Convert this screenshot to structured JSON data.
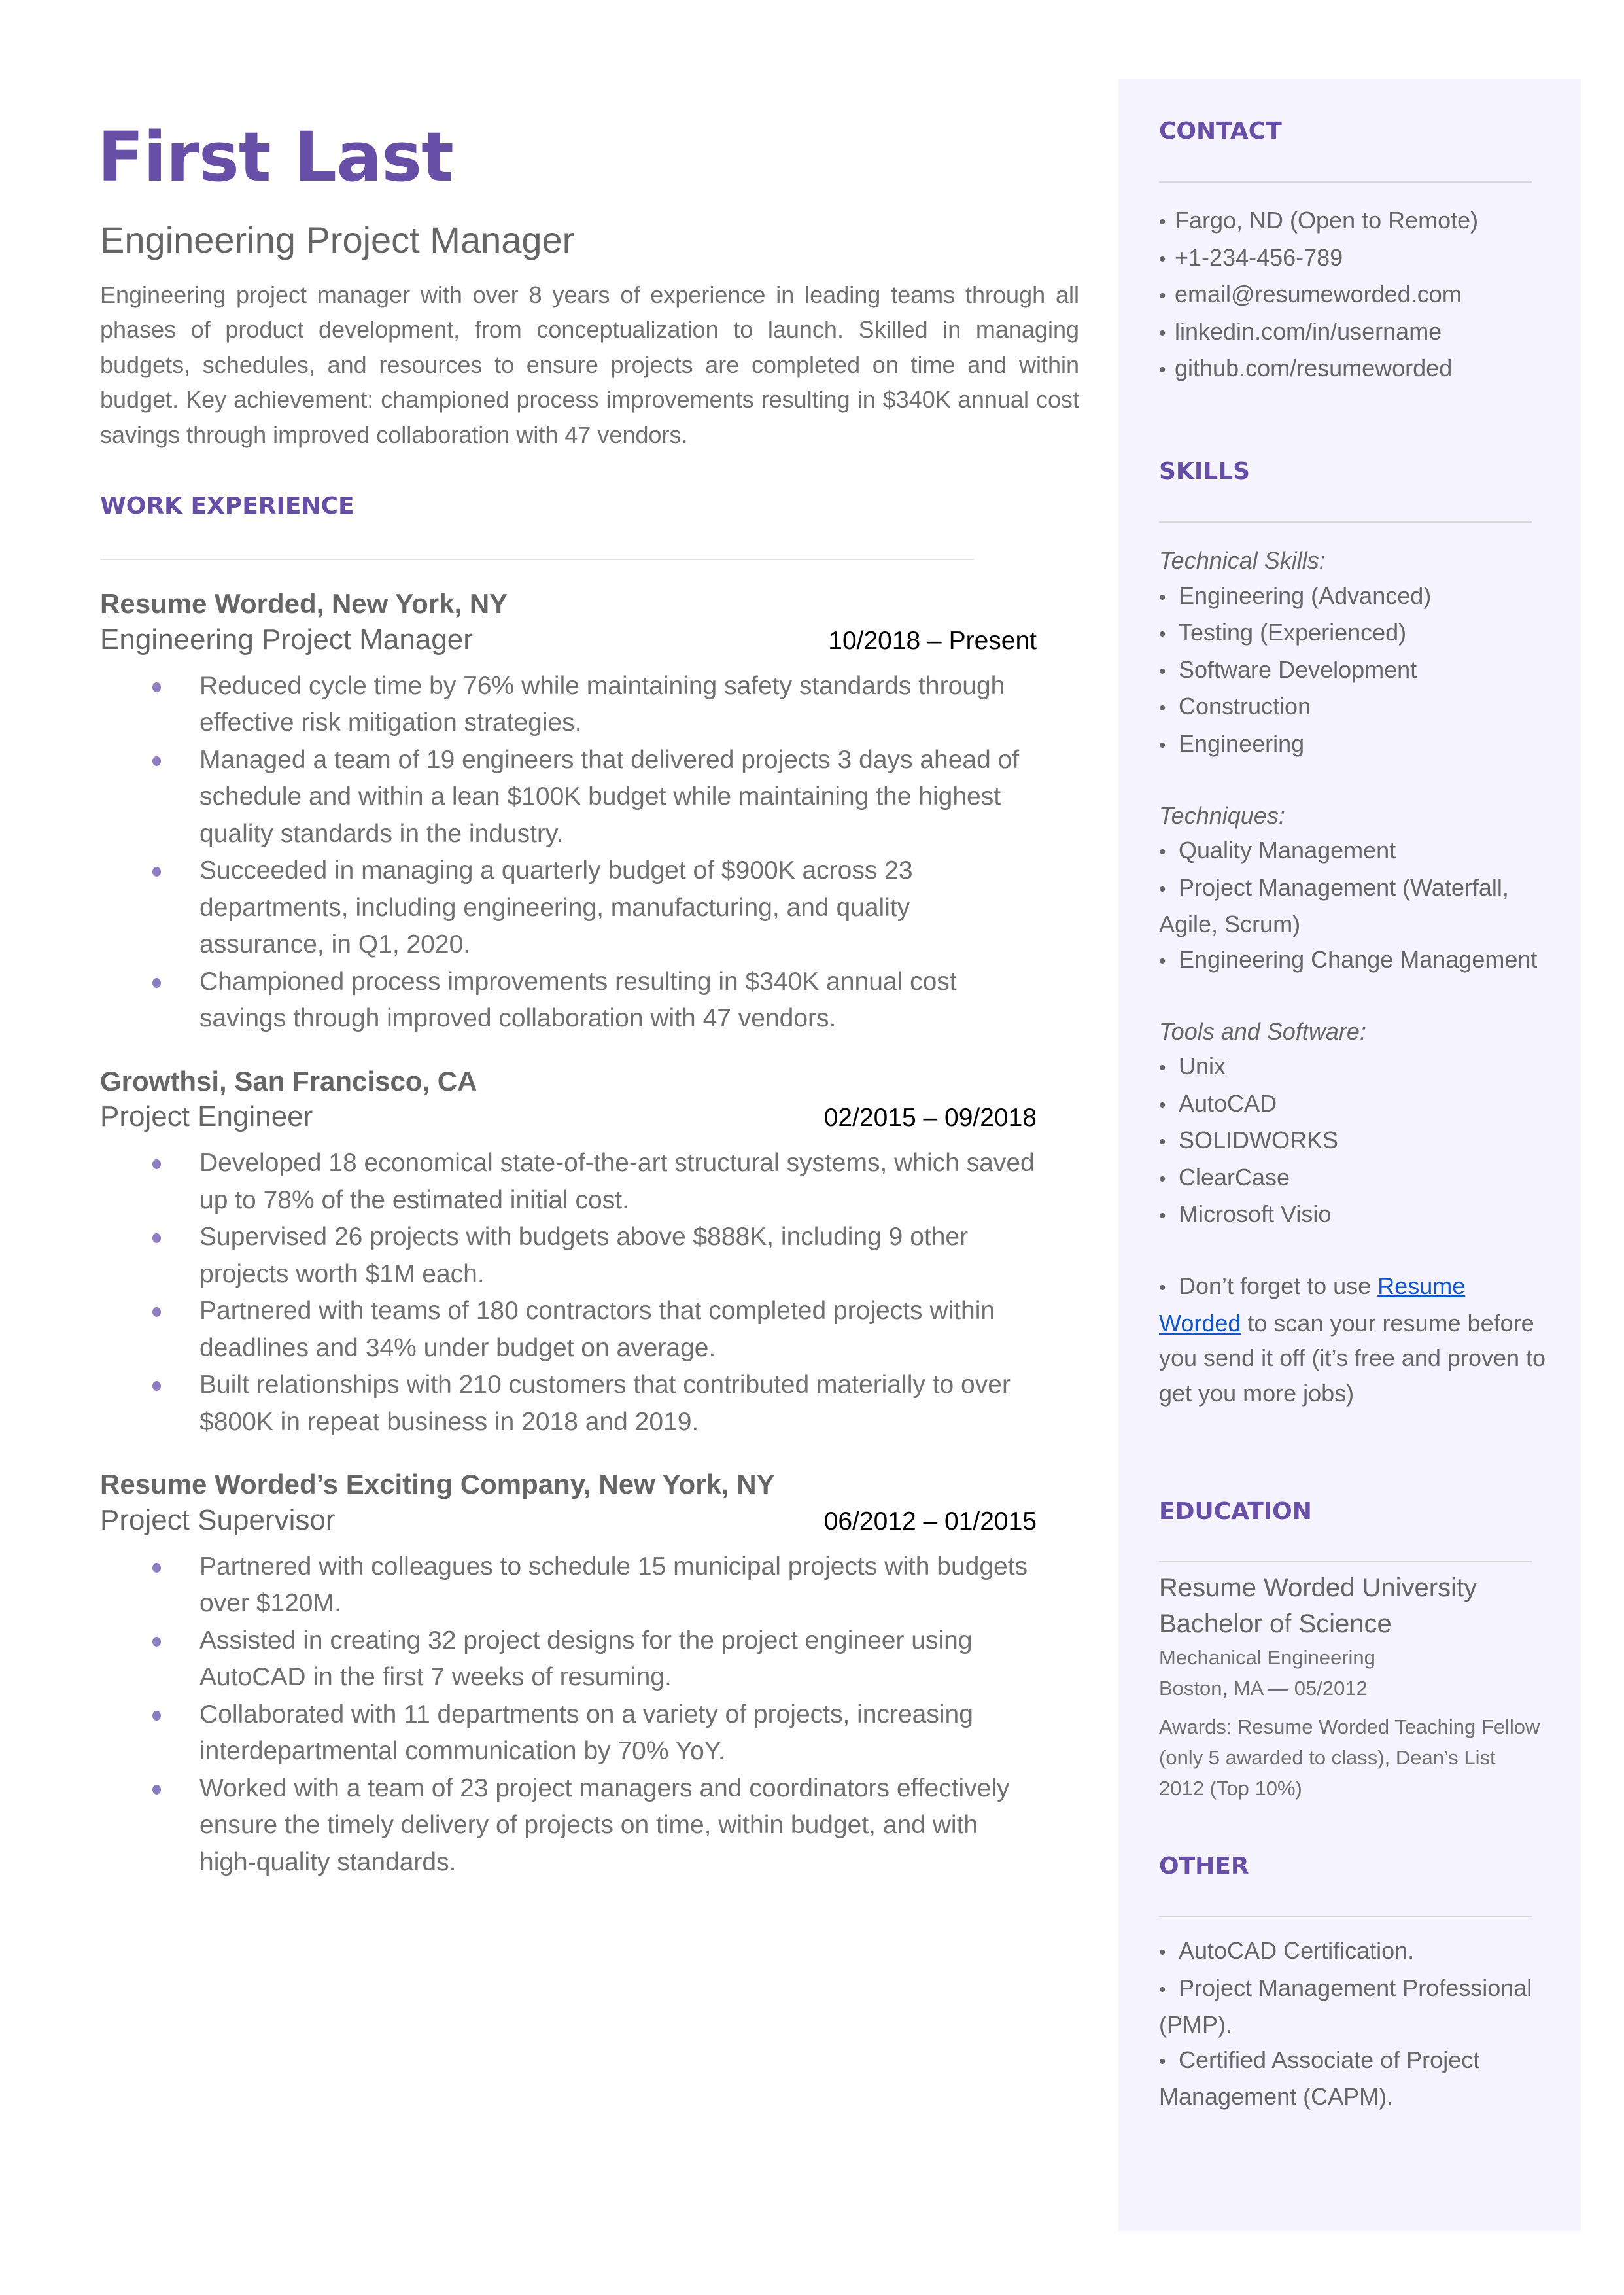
{
  "header": {
    "name": "First Last",
    "title": "Engineering Project Manager",
    "summary": "Engineering project manager with over 8 years of experience in leading teams through all phases of product development, from conceptualization to launch. Skilled in managing budgets, schedules, and resources to ensure projects are completed on time and within budget. Key achievement: championed process improvements resulting in $340K annual cost savings through improved collaboration with 47 vendors."
  },
  "colors": {
    "accent": "#674ea7",
    "bullet": "#8e7cc3",
    "sidebar_bg": "#f5f3fe",
    "link": "#1155cc",
    "body_text": "#666666"
  },
  "work": {
    "heading": "WORK EXPERIENCE",
    "jobs": [
      {
        "company": "Resume Worded, New York, NY",
        "role": "Engineering Project Manager",
        "dates": "10/2018 – Present",
        "bullets": [
          "Reduced cycle time by 76% while maintaining safety standards through effective risk mitigation strategies.",
          "Managed a team of 19 engineers that delivered projects 3 days ahead of schedule and within a lean $100K budget while maintaining the highest quality standards in the industry.",
          "Succeeded in managing a quarterly budget of $900K across 23 departments, including engineering, manufacturing, and quality assurance, in Q1, 2020.",
          "Championed process improvements resulting in $340K annual cost savings through improved collaboration with 47 vendors."
        ]
      },
      {
        "company": "Growthsi, San Francisco, CA",
        "role": "Project Engineer",
        "dates": "02/2015 – 09/2018",
        "bullets": [
          "Developed 18 economical state-of-the-art structural systems, which saved up to 78% of the estimated initial cost.",
          "Supervised 26 projects with budgets above $888K, including 9 other projects worth $1M each.",
          "Partnered with teams of 180 contractors that completed projects within deadlines and 34% under budget on average.",
          "Built relationships with 210 customers that contributed materially to over $800K in repeat business in 2018 and 2019."
        ]
      },
      {
        "company": "Resume Worded’s Exciting Company, New York, NY",
        "role": "Project Supervisor",
        "dates": "06/2012 – 01/2015",
        "bullets": [
          "Partnered with colleagues to schedule 15 municipal projects with budgets over $120M.",
          "Assisted in creating 32 project designs for the project engineer using AutoCAD in the first 7 weeks of resuming.",
          "Collaborated with 11 departments on a variety of projects, increasing interdepartmental communication by 70% YoY.",
          "Worked with a team of 23 project managers and coordinators effectively ensure the timely delivery of projects on time, within budget, and with high-quality standards."
        ]
      }
    ]
  },
  "sidebar": {
    "contact": {
      "heading": "CONTACT",
      "items": [
        "Fargo, ND (Open to Remote)",
        "+1-234-456-789",
        "email@resumeworded.com",
        "linkedin.com/in/username",
        "github.com/resumeworded"
      ]
    },
    "skills": {
      "heading": "SKILLS",
      "groups": [
        {
          "label": "Technical Skills:",
          "items": [
            "Engineering (Advanced)",
            "Testing (Experienced)",
            "Software Development",
            "Construction",
            "Engineering"
          ]
        },
        {
          "label": "Techniques:",
          "items": [
            "Project Management (Waterfall, Agile, Scrum)",
            "Engineering Change Management"
          ],
          "first_item": "Quality Management"
        },
        {
          "label": "Tools and Software:",
          "items": [
            "Unix",
            "AutoCAD",
            "SOLIDWORKS",
            "ClearCase",
            "Microsoft Visio"
          ]
        }
      ],
      "tip_prefix": "Don’t forget to use ",
      "tip_link": "Resume Worded",
      "tip_suffix": " to scan your resume before you send it off (it’s free and proven to get you more jobs)"
    },
    "education": {
      "heading": "EDUCATION",
      "school": "Resume Worded University",
      "degree": "Bachelor of Science",
      "major": "Mechanical Engineering",
      "location_date": "Boston, MA — 05/2012",
      "awards": "Awards: Resume Worded Teaching Fellow (only 5 awarded to class), Dean’s List 2012 (Top 10%)"
    },
    "other": {
      "heading": "OTHER",
      "items": [
        "AutoCAD Certification.",
        "Project Management Professional (PMP).",
        "Certified Associate of Project Management (CAPM)."
      ]
    }
  }
}
